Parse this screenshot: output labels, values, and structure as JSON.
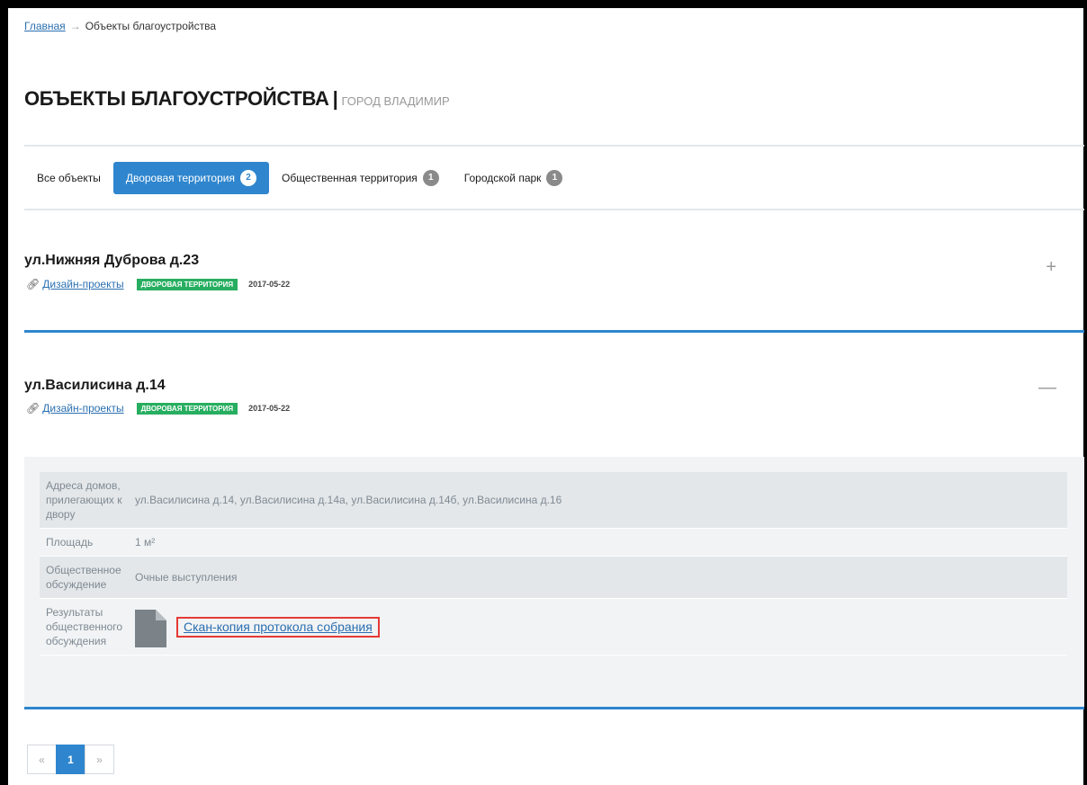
{
  "breadcrumb": {
    "home": "Главная",
    "arrow": "→",
    "current": "Объекты благоустройства"
  },
  "title": {
    "main": "ОБЪЕКТЫ БЛАГОУСТРОЙСТВА",
    "separator": "|",
    "city": "ГОРОД ВЛАДИМИР"
  },
  "tabs": [
    {
      "label": "Все объекты",
      "count": ""
    },
    {
      "label": "Дворовая территория",
      "count": "2",
      "active": true
    },
    {
      "label": "Общественная территория",
      "count": "1"
    },
    {
      "label": "Городской парк",
      "count": "1"
    }
  ],
  "items": [
    {
      "title": "ул.Нижняя Дуброва д.23",
      "design_link": "Дизайн-проекты",
      "tag": "ДВОРОВАЯ ТЕРРИТОРИЯ",
      "date": "2017-05-22",
      "toggle": "+",
      "expanded": false
    },
    {
      "title": "ул.Василисина д.14",
      "design_link": "Дизайн-проекты",
      "tag": "ДВОРОВАЯ ТЕРРИТОРИЯ",
      "date": "2017-05-22",
      "toggle": "—",
      "expanded": true
    }
  ],
  "details": {
    "addresses_label": "Адреса домов, прилегающих к двору",
    "addresses_value": "ул.Василисина д.14, ул.Василисина д.14а, ул.Василисина д.14б, ул.Василисина д.16",
    "area_label": "Площадь",
    "area_value": "1 м²",
    "discussion_label": "Общественное обсуждение",
    "discussion_value": "Очные выступления",
    "results_label": "Результаты общественного обсуждения",
    "results_file": "Скан-копия протокола собрания"
  },
  "pagination": {
    "prev": "«",
    "current": "1",
    "next": "»"
  },
  "colors": {
    "accent": "#2f86ce",
    "tag": "#27ae60",
    "highlight": "#e53935"
  }
}
